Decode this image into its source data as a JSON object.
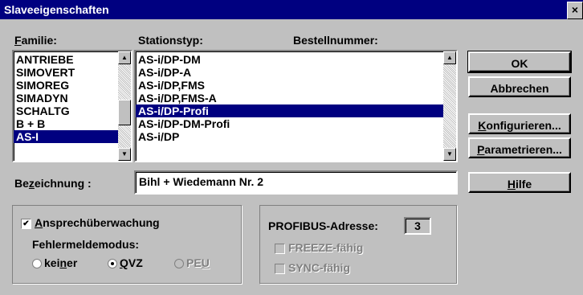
{
  "window": {
    "title": "Slaveeigenschaften",
    "close_glyph": "×"
  },
  "familie": {
    "label_u": "F",
    "label_rest": "amilie:",
    "items": [
      "ANTRIEBE",
      "SIMOVERT",
      "SIMOREG",
      "SIMADYN",
      "SCHALTG",
      "B + B",
      "AS-I"
    ],
    "selected_index": 6
  },
  "stationstyp": {
    "label": "Stationstyp:",
    "items": [
      "AS-i/DP-DM",
      "AS-i/DP-A",
      "AS-i/DP,FMS",
      "AS-i/DP,FMS-A",
      "AS-i/DP-Profi",
      "AS-i/DP-DM-Profi",
      "AS-i/DP"
    ],
    "selected_index": 4
  },
  "bestellnummer": {
    "label": "Bestellnummer:"
  },
  "buttons": {
    "ok": "OK",
    "abbrechen": "Abbrechen",
    "konfigurieren_u": "K",
    "konfigurieren_rest": "onfigurieren...",
    "parametrieren_u": "P",
    "parametrieren_rest": "arametrieren...",
    "hilfe_u": "H",
    "hilfe_rest": "ilfe"
  },
  "bezeichnung": {
    "label_a": "Be",
    "label_u": "z",
    "label_b": "eichnung :",
    "value": "Bihl + Wiedemann Nr. 2"
  },
  "ueberwachung": {
    "checkbox_u": "A",
    "checkbox_rest": "nsprechüberwachung",
    "checked": true,
    "mode_label": "Fehlermeldemodus:",
    "options": [
      {
        "a": "kei",
        "u": "n",
        "b": "er",
        "state": "off"
      },
      {
        "a": "",
        "u": "Q",
        "b": "VZ",
        "state": "on"
      },
      {
        "a": "PE",
        "u": "U",
        "b": "",
        "state": "disabled"
      }
    ]
  },
  "profibus": {
    "label": "PROFIBUS-Adresse:",
    "value": "3",
    "freeze": "FREEZE-fähig",
    "sync": "SYNC-fähig"
  }
}
